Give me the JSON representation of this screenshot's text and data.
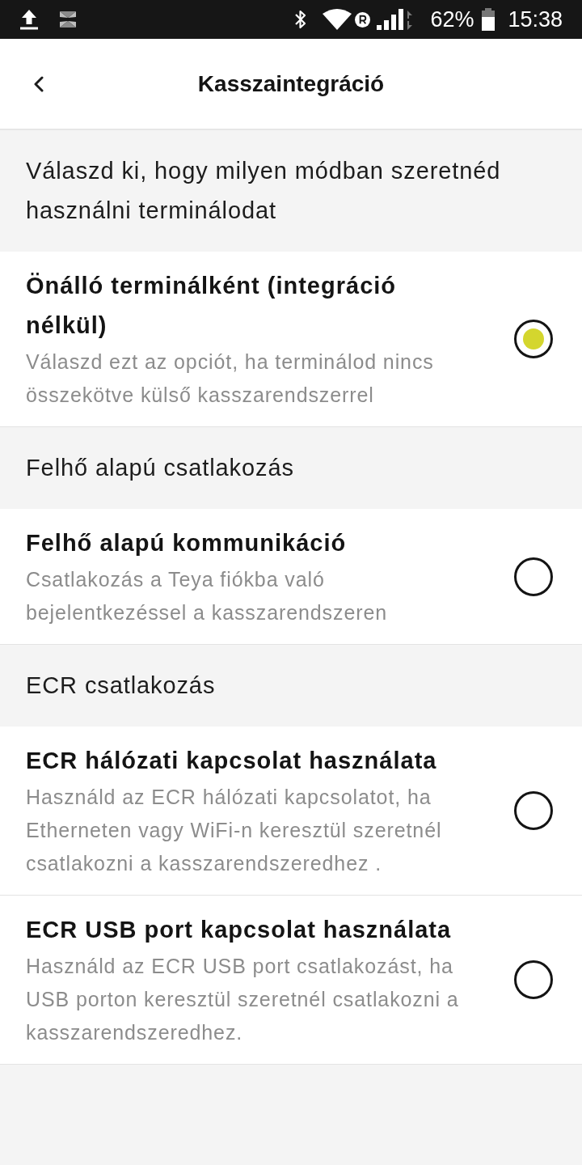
{
  "status_bar": {
    "battery": "62%",
    "time": "15:38"
  },
  "header": {
    "title": "Kasszaintegráció"
  },
  "items": [
    {
      "kind": "note",
      "text": "Válaszd ki, hogy milyen módban szeretnéd használni terminálodat"
    },
    {
      "kind": "option",
      "title": "Önálló terminálként (integráció nélkül)",
      "description": "Válaszd ezt az opciót, ha terminálod nincs összekötve külső kasszarendszerrel",
      "selected": true
    },
    {
      "kind": "heading",
      "text": "Felhő alapú csatlakozás"
    },
    {
      "kind": "option",
      "title": "Felhő alapú kommunikáció",
      "description": "Csatlakozás a Teya fiókba való bejelentkezéssel a kasszarendszeren",
      "selected": false
    },
    {
      "kind": "heading",
      "text": "ECR csatlakozás"
    },
    {
      "kind": "option",
      "title": "ECR hálózati kapcsolat használata",
      "description": "Használd az ECR hálózati kapcsolatot, ha Etherneten vagy WiFi-n keresztül szeretnél csatlakozni a kasszarendszeredhez .",
      "selected": false
    },
    {
      "kind": "option",
      "title": "ECR USB port kapcsolat használata",
      "description": "Használd az ECR USB port csatlakozást, ha USB porton keresztül szeretnél csatlakozni a kasszarendszeredhez.",
      "selected": false
    }
  ]
}
